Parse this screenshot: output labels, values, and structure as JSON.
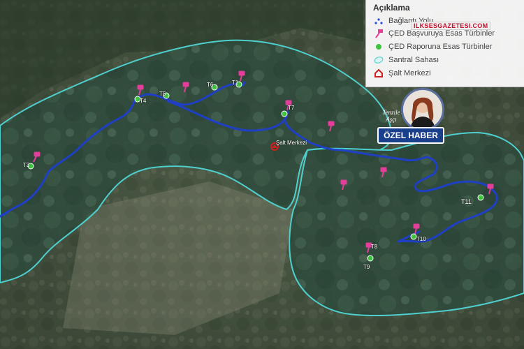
{
  "legend": {
    "title": "Açıklama",
    "items": [
      {
        "label": "Bağlantı Yolu",
        "symbol": "road-dots-icon",
        "color": "#2b4bd6"
      },
      {
        "label": "ÇED Başvuruya Esas Türbinler",
        "symbol": "pushpin-icon",
        "color": "#e23e9a"
      },
      {
        "label": "ÇED Raporuna Esas Türbinler",
        "symbol": "green-dot-icon",
        "color": "#3ec43e"
      },
      {
        "label": "Santral Sahası",
        "symbol": "area-ellipse-icon",
        "color": "#5fd3d0"
      },
      {
        "label": "Şalt Merkezi",
        "symbol": "house-icon",
        "color": "#d11f1f"
      }
    ]
  },
  "watermark": "ILKSESGAZETESI.COM",
  "badge": {
    "name_line1": "Tenzile",
    "name_line2": "Aşçı",
    "ribbon": "ÖZEL HABER"
  },
  "map": {
    "road_color": "#1f3fc4",
    "area_color": "#4fd0cf",
    "substation_label": "Şalt Merkezi",
    "turbines": [
      {
        "id": "T1",
        "label": "T1"
      },
      {
        "id": "T3",
        "label": "T3"
      },
      {
        "id": "T4",
        "label": "T4"
      },
      {
        "id": "T5",
        "label": "T5"
      },
      {
        "id": "T6",
        "label": "T6"
      },
      {
        "id": "T7",
        "label": "T7"
      },
      {
        "id": "T8",
        "label": "T8"
      },
      {
        "id": "T9",
        "label": "T9"
      },
      {
        "id": "T10",
        "label": "T10"
      },
      {
        "id": "T11",
        "label": "T11"
      }
    ]
  }
}
